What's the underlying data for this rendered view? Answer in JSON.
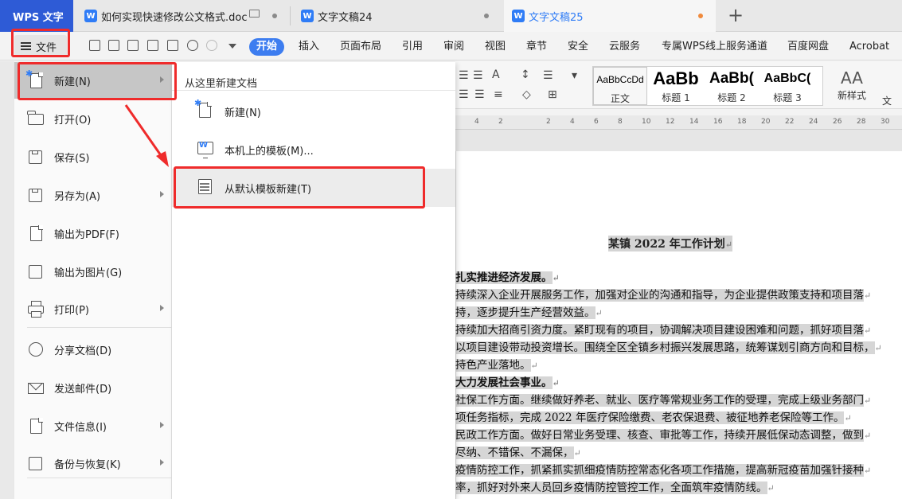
{
  "tabs": {
    "app_label": "WPS 文字",
    "items": [
      {
        "label": "如何实现快速修改公文格式.doc"
      },
      {
        "label": "文字文稿24"
      },
      {
        "label": "文字文稿25"
      }
    ],
    "new_tab": "+"
  },
  "menubar": {
    "file_label": "文件",
    "tabs": [
      "开始",
      "插入",
      "页面布局",
      "引用",
      "审阅",
      "视图",
      "章节",
      "安全",
      "云服务",
      "专属WPS线上服务通道",
      "百度网盘",
      "Acrobat"
    ]
  },
  "ribbon": {
    "styles": [
      {
        "preview": "AaBbCcDd",
        "label": "正文"
      },
      {
        "preview": "AaBb",
        "label": "标题 1"
      },
      {
        "preview": "AaBb(",
        "label": "标题 2"
      },
      {
        "preview": "AaBbC(",
        "label": "标题 3"
      }
    ],
    "new_style_label": "新样式",
    "new_style_icon": "AA",
    "text_label": "文"
  },
  "ruler": {
    "ticks": [
      "4",
      "2",
      "",
      "2",
      "4",
      "6",
      "8",
      "10",
      "12",
      "14",
      "16",
      "18",
      "20",
      "22",
      "24",
      "26",
      "28",
      "30"
    ]
  },
  "file_menu": {
    "items": [
      {
        "label": "新建(N)",
        "icon": "new-doc-icon",
        "arrow": true
      },
      {
        "label": "打开(O)",
        "icon": "open-folder-icon",
        "arrow": false
      },
      {
        "label": "保存(S)",
        "icon": "save-icon",
        "arrow": false
      },
      {
        "label": "另存为(A)",
        "icon": "save-as-icon",
        "arrow": true
      },
      {
        "label": "输出为PDF(F)",
        "icon": "export-pdf-icon",
        "arrow": false
      },
      {
        "label": "输出为图片(G)",
        "icon": "export-image-icon",
        "arrow": false
      },
      {
        "label": "打印(P)",
        "icon": "printer-icon",
        "arrow": true
      },
      {
        "label": "分享文档(D)",
        "icon": "share-icon",
        "arrow": false
      },
      {
        "label": "发送邮件(D)",
        "icon": "mail-icon",
        "arrow": false
      },
      {
        "label": "文件信息(I)",
        "icon": "file-info-icon",
        "arrow": true
      },
      {
        "label": "备份与恢复(K)",
        "icon": "backup-icon",
        "arrow": true
      }
    ]
  },
  "submenu": {
    "header": "从这里新建文档",
    "items": [
      {
        "label": "新建(N)",
        "icon": "new-doc-icon"
      },
      {
        "label": "本机上的模板(M)...",
        "icon": "local-template-icon"
      },
      {
        "label": "从默认模板新建(T)",
        "icon": "default-template-icon"
      }
    ]
  },
  "document": {
    "title": "某镇 2022 年工作计划",
    "lines": [
      {
        "text": "扎实推进经济发展。",
        "heading": true
      },
      {
        "text": "持续深入企业开展服务工作，加强对企业的沟通和指导，为企业提供政策支持和项目落",
        "heading": false
      },
      {
        "text": "持，逐步提升生产经营效益。",
        "heading": false
      },
      {
        "text": "持续加大招商引资力度。紧盯现有的项目，协调解决项目建设困难和问题，抓好项目落",
        "heading": false
      },
      {
        "text": "以项目建设带动投资增长。围绕全区全镇乡村振兴发展思路，统筹谋划引商方向和目标，",
        "heading": false
      },
      {
        "text": "持色产业落地。",
        "heading": false
      },
      {
        "text": "大力发展社会事业。",
        "heading": true
      },
      {
        "text": "社保工作方面。继续做好养老、就业、医疗等常规业务工作的受理，完成上级业务部门",
        "heading": false
      },
      {
        "text": "项任务指标，完成 2022 年医疗保险缴费、老农保退费、被征地养老保险等工作。",
        "heading": false
      },
      {
        "text": "民政工作方面。做好日常业务受理、核查、审批等工作，持续开展低保动态调整，做到",
        "heading": false
      },
      {
        "text": "尽纳、不错保、不漏保，",
        "heading": false
      },
      {
        "text": "疫情防控工作，抓紧抓实抓细疫情防控常态化各项工作措施，提高新冠疫苗加强针接种",
        "heading": false
      },
      {
        "text": "率，抓好对外来人员回乡疫情防控管控工作，全面筑牢疫情防线。",
        "heading": false
      }
    ],
    "paragraph_mark": "↵"
  },
  "colors": {
    "accent": "#3d7df0",
    "highlight_box": "#ef2b2b",
    "selection": "#d6d6d6"
  }
}
